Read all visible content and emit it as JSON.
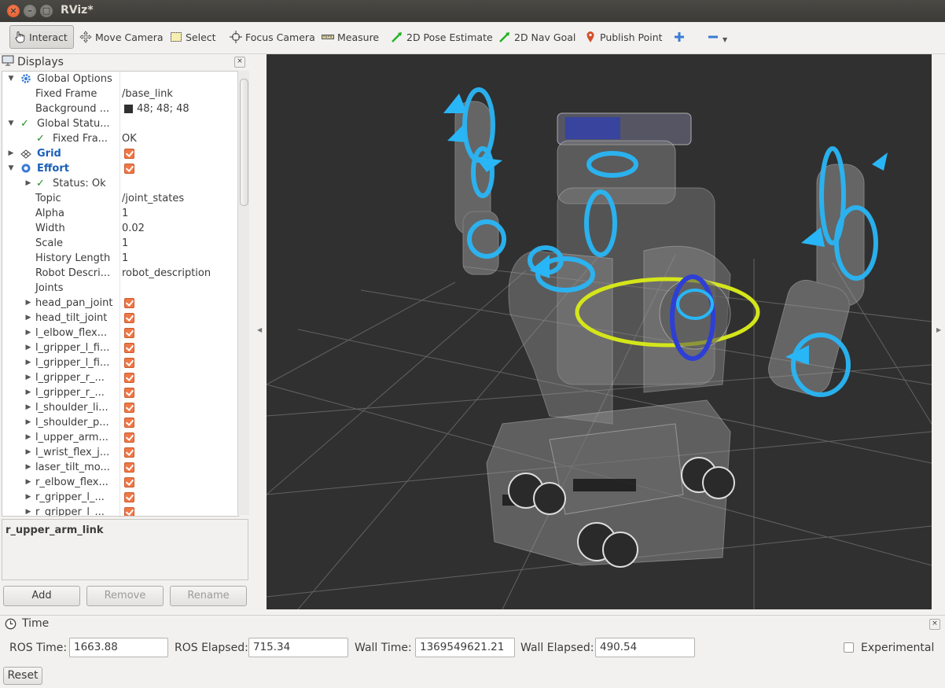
{
  "window": {
    "title": "RViz*"
  },
  "toolbar": {
    "tools": [
      {
        "label": "Interact",
        "icon": "hand-pointer-icon"
      },
      {
        "label": "Move Camera",
        "icon": "move-camera-icon"
      },
      {
        "label": "Select",
        "icon": "select-rect-icon"
      },
      {
        "label": "Focus Camera",
        "icon": "crosshair-icon"
      },
      {
        "label": "Measure",
        "icon": "ruler-icon"
      },
      {
        "label": "2D Pose Estimate",
        "icon": "green-arrow-icon"
      },
      {
        "label": "2D Nav Goal",
        "icon": "green-arrow-icon"
      },
      {
        "label": "Publish Point",
        "icon": "map-pin-icon"
      }
    ],
    "add_icon": "plus-icon",
    "remove_icon": "minus-icon"
  },
  "displays": {
    "title": "Displays",
    "tree": [
      {
        "key": "Global Options",
        "value": ""
      },
      {
        "key": "Fixed Frame",
        "value": "/base_link"
      },
      {
        "key": "Background ...",
        "value": "48; 48; 48"
      },
      {
        "key": "Global Statu...",
        "value": ""
      },
      {
        "key": "Fixed Fra...",
        "value": "OK"
      },
      {
        "key": "Grid",
        "value": ""
      },
      {
        "key": "Effort",
        "value": ""
      },
      {
        "key": "Status: Ok",
        "value": ""
      },
      {
        "key": "Topic",
        "value": "/joint_states"
      },
      {
        "key": "Alpha",
        "value": "1"
      },
      {
        "key": "Width",
        "value": "0.02"
      },
      {
        "key": "Scale",
        "value": "1"
      },
      {
        "key": "History Length",
        "value": "1"
      },
      {
        "key": "Robot Descri...",
        "value": "robot_description"
      },
      {
        "key": "Joints",
        "value": ""
      },
      {
        "key": "head_pan_joint",
        "value": ""
      },
      {
        "key": "head_tilt_joint",
        "value": ""
      },
      {
        "key": "l_elbow_flex...",
        "value": ""
      },
      {
        "key": "l_gripper_l_fi...",
        "value": ""
      },
      {
        "key": "l_gripper_l_fi...",
        "value": ""
      },
      {
        "key": "l_gripper_r_...",
        "value": ""
      },
      {
        "key": "l_gripper_r_...",
        "value": ""
      },
      {
        "key": "l_shoulder_li...",
        "value": ""
      },
      {
        "key": "l_shoulder_p...",
        "value": ""
      },
      {
        "key": "l_upper_arm...",
        "value": ""
      },
      {
        "key": "l_wrist_flex_j...",
        "value": ""
      },
      {
        "key": "laser_tilt_mo...",
        "value": ""
      },
      {
        "key": "r_elbow_flex...",
        "value": ""
      },
      {
        "key": "r_gripper_l_...",
        "value": ""
      },
      {
        "key": "r_gripper_l_...",
        "value": ""
      }
    ],
    "description": "r_upper_arm_link",
    "buttons": {
      "add": "Add",
      "remove": "Remove",
      "rename": "Rename"
    }
  },
  "colors": {
    "background": "#303030",
    "effort_rings": "#29b6f6",
    "selection_ring": "#d4e61a",
    "checkbox": "#f07746"
  },
  "time": {
    "title": "Time",
    "ros_time_label": "ROS Time:",
    "ros_time": "1663.88",
    "ros_elapsed_label": "ROS Elapsed:",
    "ros_elapsed": "715.34",
    "wall_time_label": "Wall Time:",
    "wall_time": "1369549621.21",
    "wall_elapsed_label": "Wall Elapsed:",
    "wall_elapsed": "490.54",
    "experimental_label": "Experimental",
    "reset_label": "Reset"
  }
}
